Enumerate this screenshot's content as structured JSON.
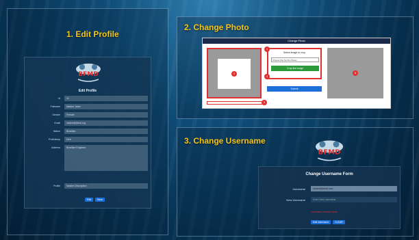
{
  "panels": {
    "edit_profile": {
      "title": "1. Edit Profile",
      "logo_text": "BFMD",
      "form_title": "Edit Profile",
      "fields": [
        {
          "label": "Id",
          "value": "41"
        },
        {
          "label": "Fullname",
          "value": "Nadine Jaber"
        },
        {
          "label": "Gender",
          "value": "Female"
        },
        {
          "label": "Email",
          "value": "nadine@bfmd.org"
        },
        {
          "label": "Nation",
          "value": "Brazilian"
        },
        {
          "label": "Proficiency",
          "value": "Dive"
        },
        {
          "label": "Address",
          "value": "Brazilian Engineer"
        }
      ],
      "profile_label": "Profile",
      "profile_value": "Nadine Description",
      "buttons": [
        "Edit",
        "Save"
      ]
    },
    "change_photo": {
      "title": "2. Change Photo",
      "dialog_title": "Change Photo",
      "select_label": "Select image to crop",
      "file_button": "Choose File",
      "file_status": "No file chosen",
      "crop_button": "Crop the image",
      "submit_button": "Submit",
      "markers": [
        "1",
        "2",
        "3",
        "4",
        "5"
      ]
    },
    "change_username": {
      "title": "3. Change Username",
      "logo_text": "BFMD",
      "form_title": "Change Username Form",
      "username_label": "Username",
      "username_value": "nadine@bfmd.com",
      "new_username_label": "New Username",
      "new_username_placeholder": "Enter New Username",
      "error_text": "Username already exists",
      "buttons": [
        "Edit Username",
        "CLEAR"
      ]
    }
  },
  "colors": {
    "title": "#f5c518",
    "marker": "#e03030",
    "primary": "#1c6fd9",
    "crop": "#2a9a3a"
  }
}
